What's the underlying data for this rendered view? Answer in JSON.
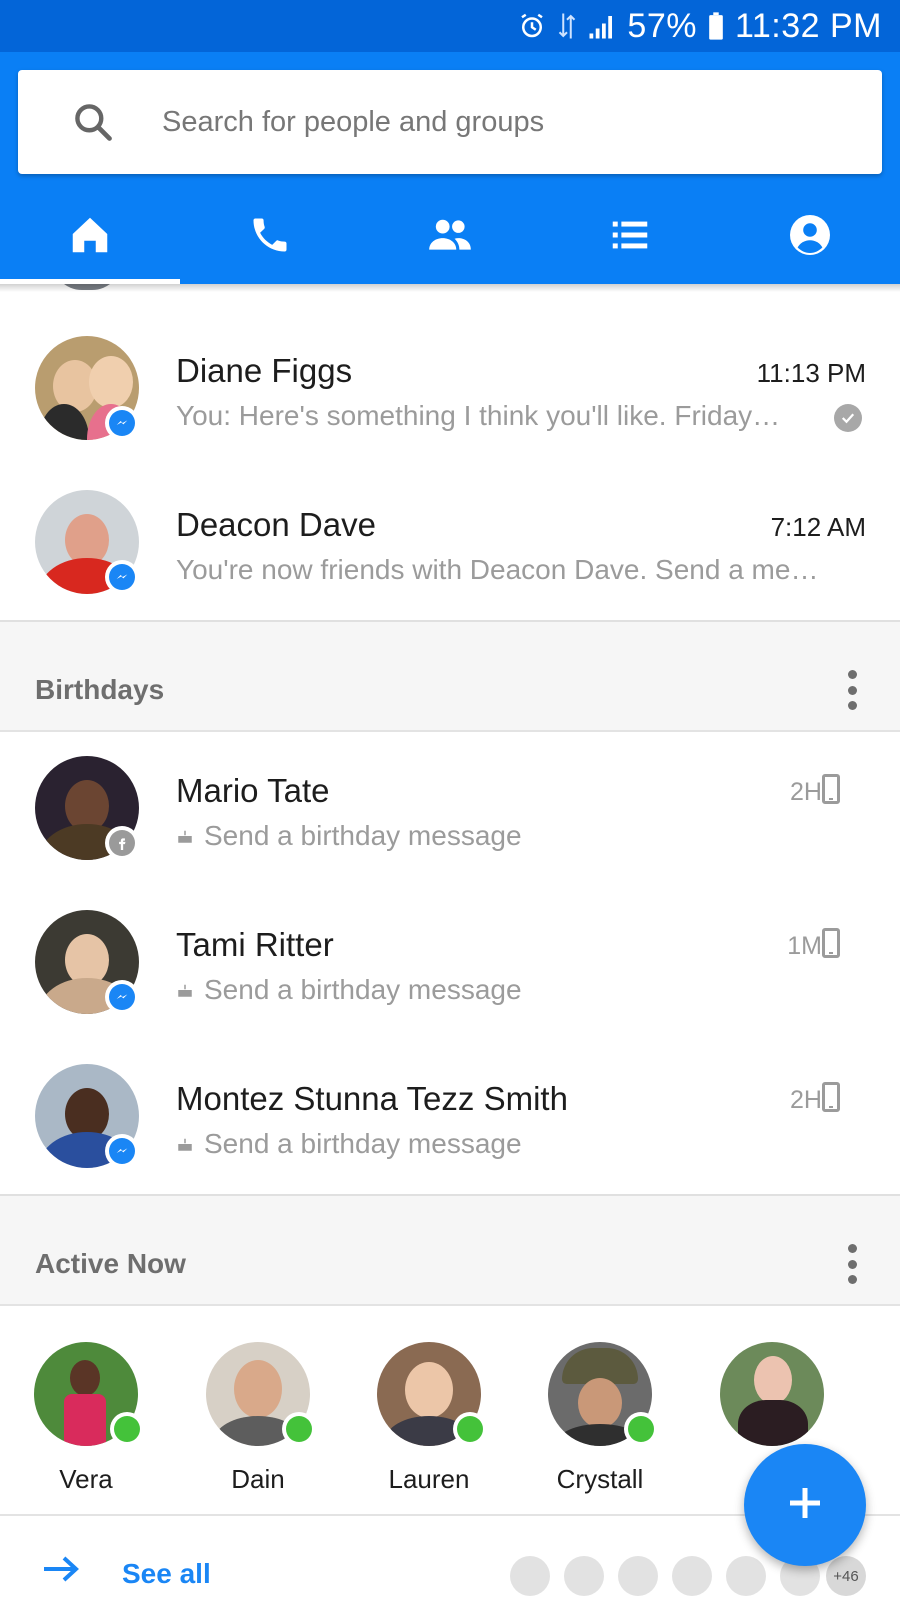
{
  "status_bar": {
    "battery": "57%",
    "time": "11:32 PM",
    "network": "4G LTE",
    "icons": [
      "alarm-icon",
      "network-icon",
      "signal-icon",
      "battery-icon"
    ]
  },
  "search": {
    "placeholder": "Search for people and groups"
  },
  "tabs": [
    {
      "icon": "home-icon",
      "active": true
    },
    {
      "icon": "phone-icon",
      "active": false
    },
    {
      "icon": "people-icon",
      "active": false
    },
    {
      "icon": "list-icon",
      "active": false
    },
    {
      "icon": "profile-icon",
      "active": false
    }
  ],
  "conversations": [
    {
      "name": "Diane Figgs",
      "time": "11:13 PM",
      "snippet": "You: Here's something I think you'll like. Friday…",
      "badge": "messenger",
      "read": true
    },
    {
      "name": "Deacon Dave",
      "time": "7:12 AM",
      "snippet": "You're now friends with Deacon Dave. Send a me…",
      "badge": "messenger",
      "read": false
    }
  ],
  "birthdays": {
    "title": "Birthdays",
    "items": [
      {
        "name": "Mario Tate",
        "ago": "2H",
        "message": "Send a birthday message",
        "badge": "facebook"
      },
      {
        "name": "Tami Ritter",
        "ago": "1M",
        "message": "Send a birthday message",
        "badge": "messenger"
      },
      {
        "name": "Montez Stunna Tezz Smith",
        "ago": "2H",
        "message": "Send a birthday message",
        "badge": "messenger"
      }
    ]
  },
  "active_now": {
    "title": "Active Now",
    "people": [
      {
        "name": "Vera"
      },
      {
        "name": "Dain"
      },
      {
        "name": "Lauren"
      },
      {
        "name": "Crystall"
      },
      {
        "name": ""
      }
    ],
    "see_all": "See all",
    "more_count": "+46"
  },
  "colors": {
    "status_bar": "#0365d8",
    "header": "#0a7ff5",
    "accent": "#1a86f5",
    "online": "#44c23a"
  }
}
